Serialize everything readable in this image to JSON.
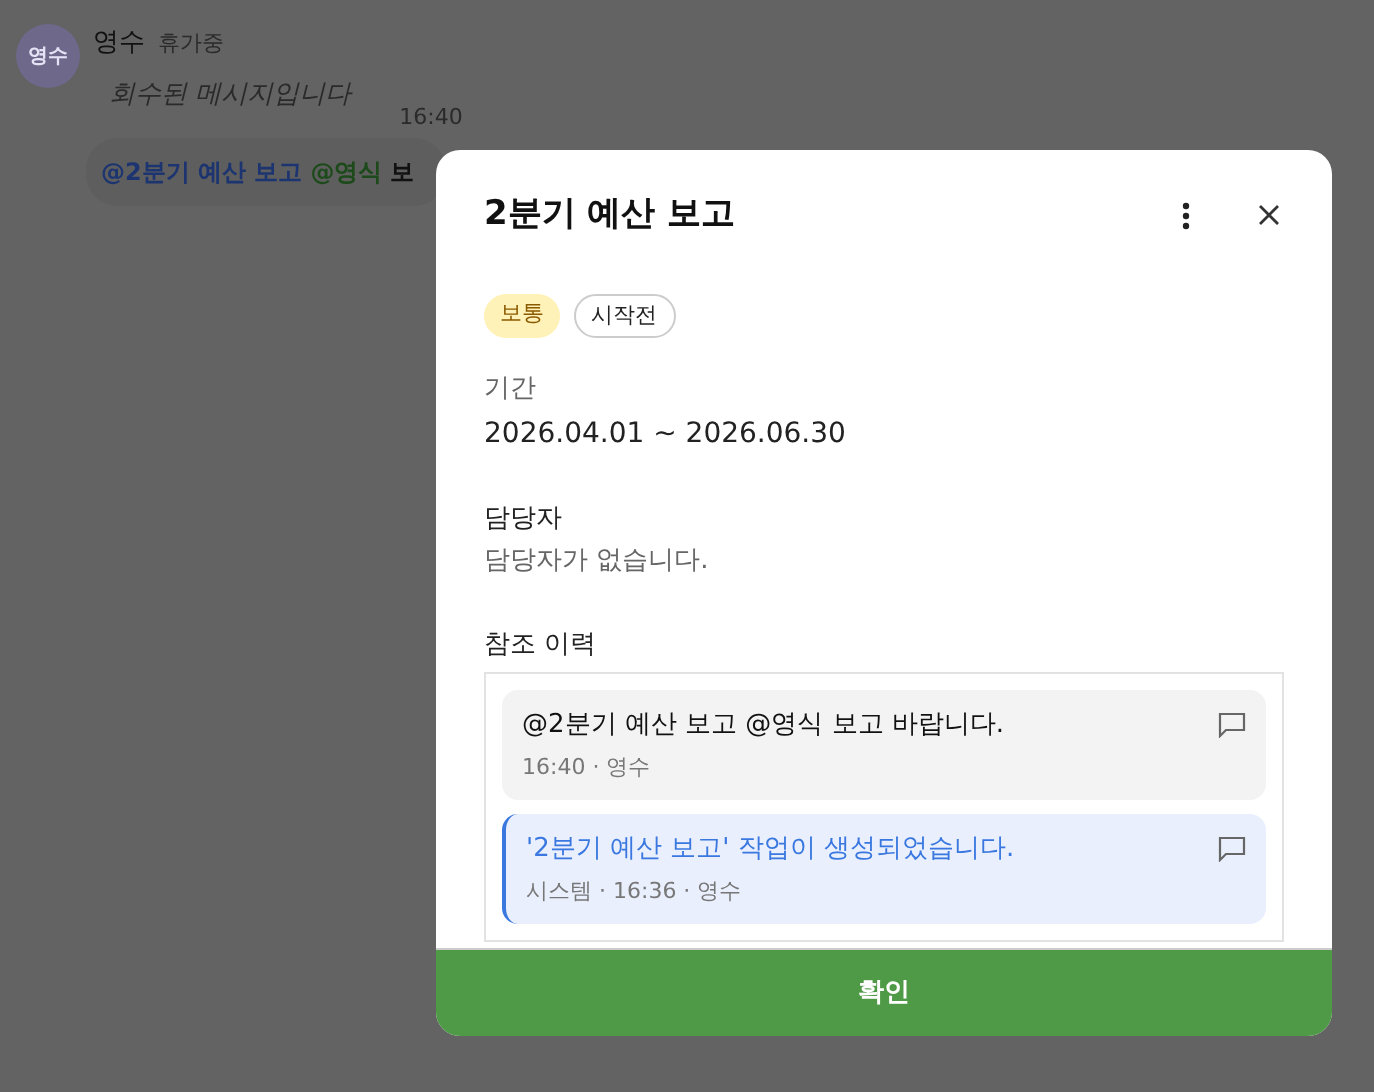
{
  "chat": {
    "avatar": "영수",
    "name": "영수",
    "status": "휴가중",
    "recalled_message": "회수된 메시지입니다",
    "time": "16:40",
    "bubble": [
      {
        "kind": "mention",
        "text": "@2분기 예산 보고",
        "color": "#1c3470"
      },
      {
        "kind": "mention",
        "text": "@영식",
        "color": "#1d4a1a"
      },
      {
        "kind": "text",
        "text": "보"
      }
    ]
  },
  "modal": {
    "title": "2분기 예산 보고",
    "tags": [
      {
        "kind": "filled",
        "label": "보통"
      },
      {
        "kind": "outline",
        "label": "시작전"
      }
    ],
    "period": {
      "label": "기간",
      "value": "2026.04.01 ~ 2026.06.30"
    },
    "assignee": {
      "label": "담당자",
      "value": "담당자가 없습니다."
    },
    "history": {
      "label": "참조 이력",
      "items": [
        {
          "kind": "mention",
          "text": "@2분기 예산 보고  @영식 보고 바랍니다.",
          "meta": "16:40 · 영수"
        },
        {
          "kind": "system",
          "text": "'2분기 예산 보고' 작업이 생성되었습니다.",
          "meta": "시스템 · 16:36 · 영수"
        }
      ]
    },
    "confirm_button": "확인"
  }
}
